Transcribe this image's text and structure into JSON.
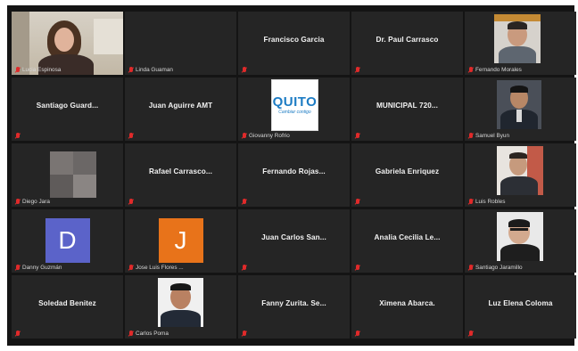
{
  "tiles": [
    {
      "name": "",
      "label": "Lucia Espinosa"
    },
    {
      "name": "",
      "label": "Linda Guaman"
    },
    {
      "name": "Francisco Garcia",
      "label": ""
    },
    {
      "name": "Dr. Paul Carrasco",
      "label": ""
    },
    {
      "name": "",
      "label": "Fernando Morales"
    },
    {
      "name": "Santiago  Guard...",
      "label": ""
    },
    {
      "name": "Juan Aguirre AMT",
      "label": ""
    },
    {
      "name": "",
      "label": "Giovanny Rofrio"
    },
    {
      "name": "MUNICIPAL  720...",
      "label": ""
    },
    {
      "name": "",
      "label": "Samuel Byun"
    },
    {
      "name": "",
      "label": "Diego Jara"
    },
    {
      "name": "Rafael  Carrasco...",
      "label": ""
    },
    {
      "name": "Fernando  Rojas...",
      "label": ""
    },
    {
      "name": "Gabriela Enriquez",
      "label": ""
    },
    {
      "name": "",
      "label": "Luis Robles"
    },
    {
      "name": "",
      "label": "Danny Guzmán"
    },
    {
      "name": "",
      "label": "Jose Luis Flores ..."
    },
    {
      "name": "Juan Carlos  San...",
      "label": ""
    },
    {
      "name": "Analia  Cecilia  Le...",
      "label": ""
    },
    {
      "name": "",
      "label": "Santiago Jaramillo"
    },
    {
      "name": "Soledad Benitez",
      "label": ""
    },
    {
      "name": "",
      "label": "Carlos Poma"
    },
    {
      "name": "Fanny  Zurita.  Se...",
      "label": ""
    },
    {
      "name": "Ximena Abarca.",
      "label": ""
    },
    {
      "name": "Luz Elena Coloma",
      "label": ""
    }
  ],
  "avatars": {
    "danny": "D",
    "jose": "J"
  },
  "logo": {
    "text": "QUITO",
    "tagline": "Cambiar contigo"
  },
  "colors": {
    "mic_muted": "#e02a2a",
    "tile_bg": "#252525",
    "avatar_d": "#5b63c9",
    "avatar_j": "#e8731a"
  }
}
